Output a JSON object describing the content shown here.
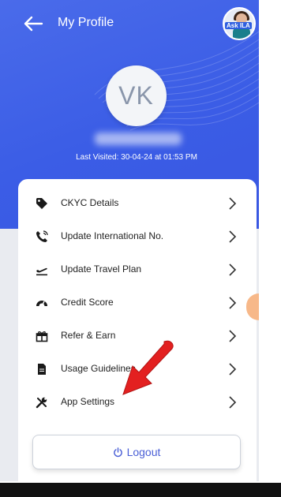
{
  "header": {
    "title": "My Profile"
  },
  "assistant": {
    "badge": "Ask ILA"
  },
  "profile": {
    "initials": "VK",
    "last_visited": "Last Visited: 30-04-24 at 01:53 PM"
  },
  "menu": {
    "items": [
      {
        "label": "CKYC Details",
        "icon": "tag-icon"
      },
      {
        "label": "Update International No.",
        "icon": "phone-icon"
      },
      {
        "label": "Update Travel Plan",
        "icon": "flight-icon"
      },
      {
        "label": "Credit Score",
        "icon": "speedometer-icon"
      },
      {
        "label": "Refer & Earn",
        "icon": "gift-icon"
      },
      {
        "label": "Usage Guidelines",
        "icon": "document-icon"
      },
      {
        "label": "App Settings",
        "icon": "tools-icon"
      }
    ]
  },
  "logout": {
    "label": "Logout"
  },
  "colors": {
    "header_blue": "#3b5de6",
    "logout_text": "#4a5fd6",
    "arrow_red": "#e32020"
  }
}
